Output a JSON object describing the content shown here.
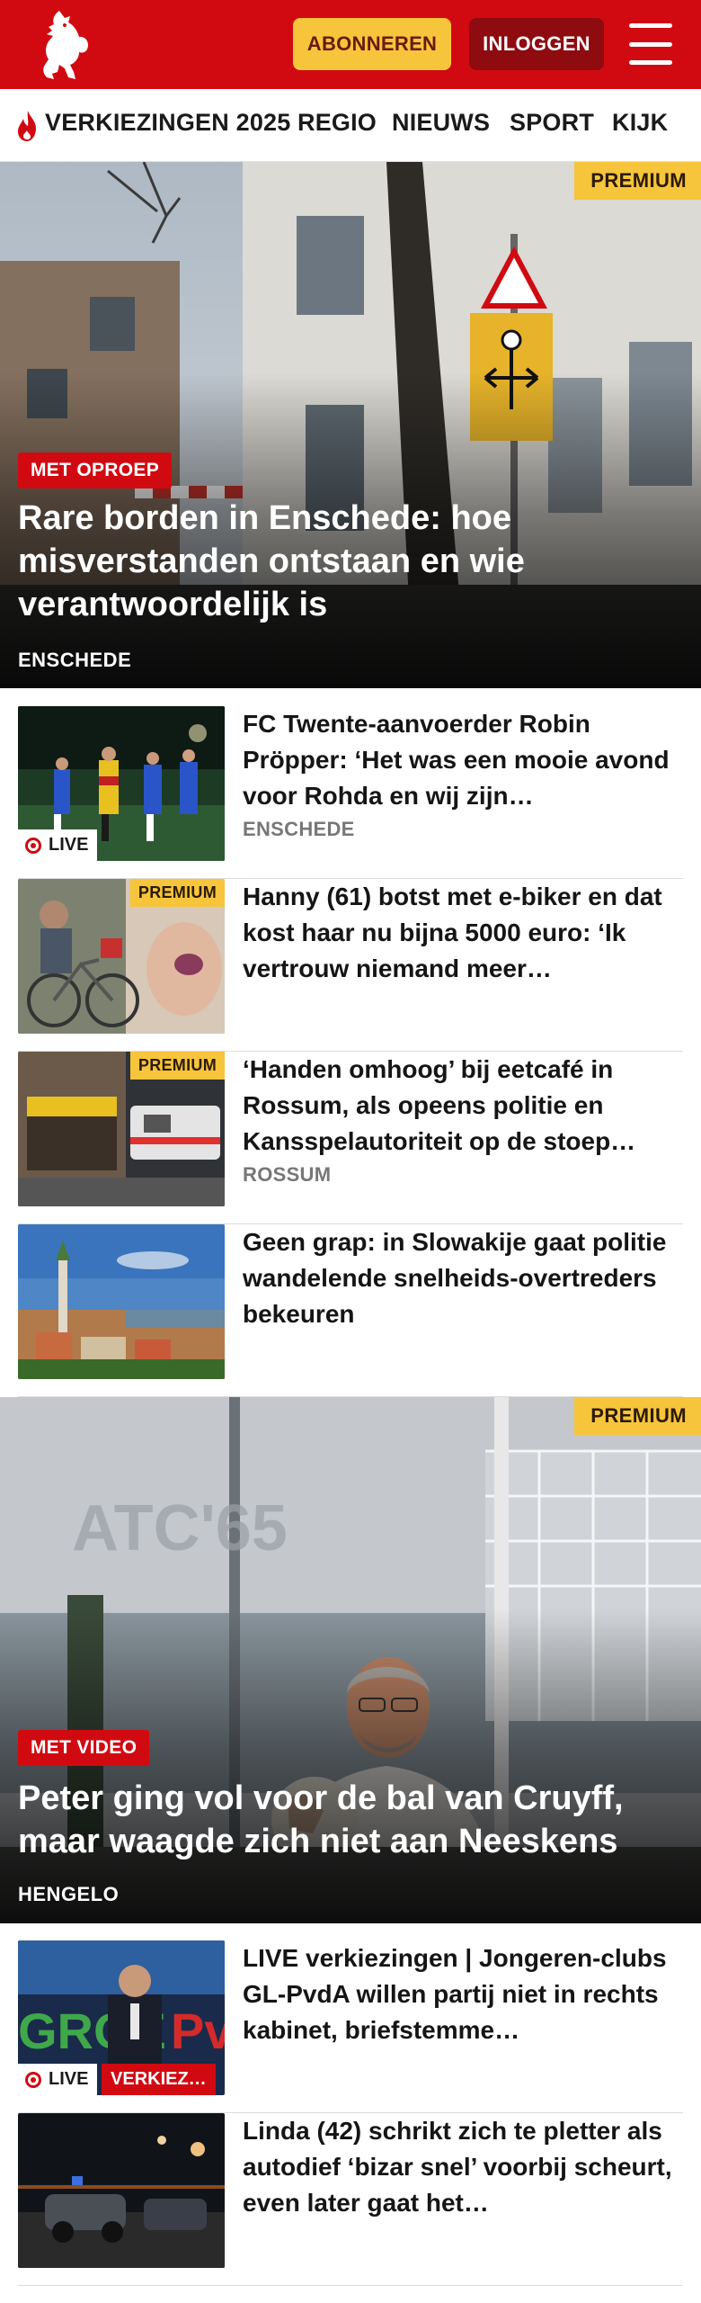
{
  "header": {
    "subscribe_label": "ABONNEREN",
    "login_label": "INLOGGEN",
    "brand_color": "#d10a11"
  },
  "nav": {
    "items": [
      {
        "label": "VERKIEZINGEN 2025",
        "icon": "flame-icon"
      },
      {
        "label": "REGIO"
      },
      {
        "label": "NIEUWS"
      },
      {
        "label": "SPORT"
      },
      {
        "label": "KIJK"
      }
    ]
  },
  "hero1": {
    "premium": "PREMIUM",
    "tag": "MET OPROEP",
    "title": "Rare borden in Enschede: hoe misverstanden ontstaan en wie verantwoordelijk is",
    "location": "ENSCHEDE"
  },
  "list1": [
    {
      "title": "FC Twente-aanvoerder Robin Pröpper: ‘Het was een mooie avond voor Rohda en wij zijn…",
      "location": "ENSCHEDE",
      "badge": "LIVE"
    },
    {
      "title": "Hanny (61) botst met e-biker en dat kost haar nu bijna 5000 euro: ‘Ik vertrouw niemand meer…",
      "premium": "PREMIUM"
    },
    {
      "title": "‘Handen omhoog’ bij eetcafé in Rossum, als opeens politie en Kansspelautoriteit op de stoep…",
      "location": "ROSSUM",
      "premium": "PREMIUM"
    },
    {
      "title": "Geen grap: in Slowakije gaat politie wandelende snelheids-overtreders bekeuren"
    }
  ],
  "hero2": {
    "premium": "PREMIUM",
    "tag": "MET VIDEO",
    "title": "Peter ging vol voor de bal van Cruyff, maar waagde zich niet aan Neeskens",
    "location": "HENGELO"
  },
  "list2": [
    {
      "title": "LIVE verkiezingen | Jongeren-clubs GL-PvdA willen partij niet in rechts kabinet, briefstemme…",
      "badge": "LIVE",
      "tag": "VERKIEZ…"
    },
    {
      "title": "Linda (42) schrikt zich te pletter als autodief ‘bizar snel’ voorbij scheurt, even later gaat het…"
    }
  ]
}
